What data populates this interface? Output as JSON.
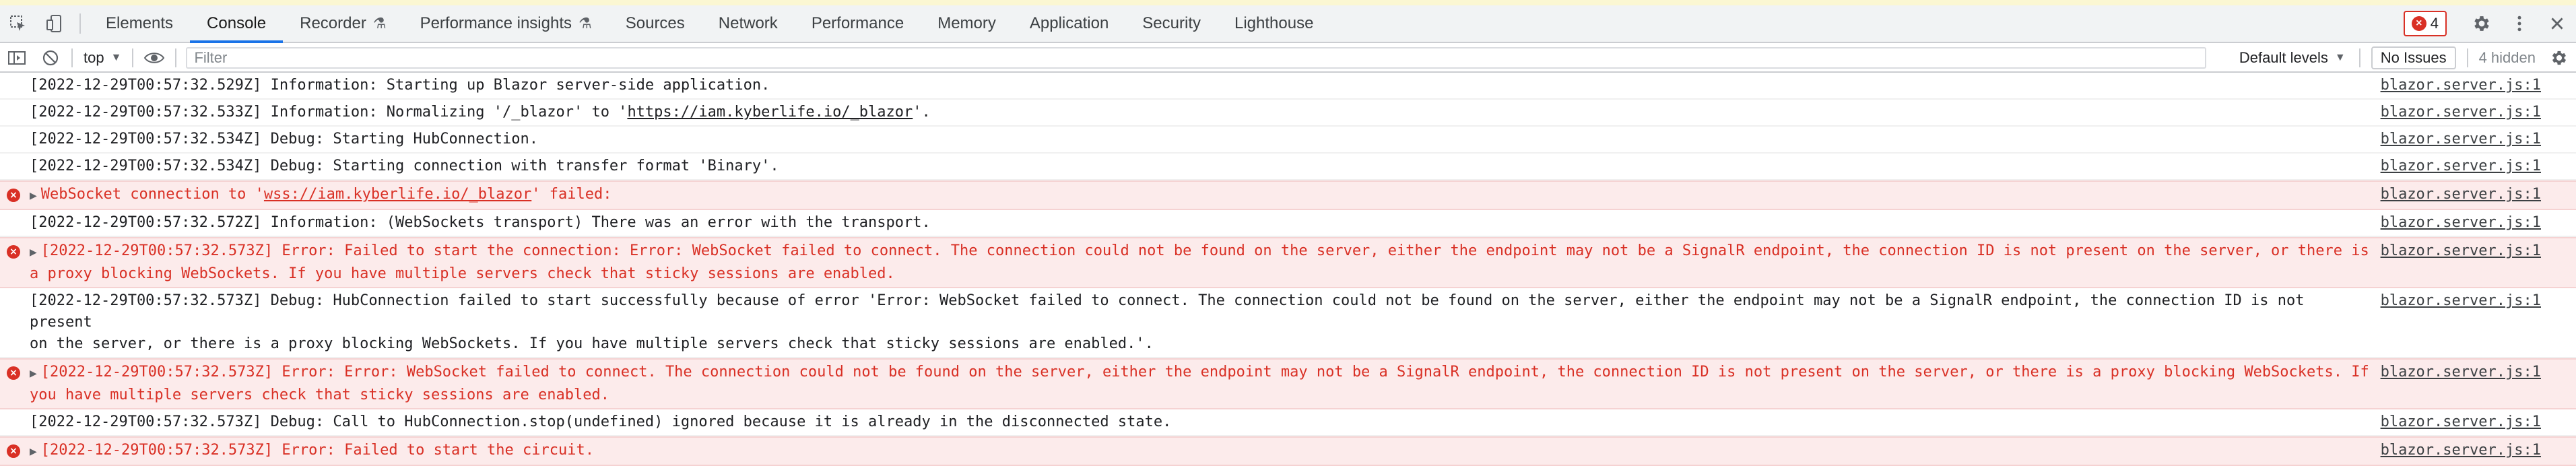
{
  "tabs": [
    {
      "label": "Elements"
    },
    {
      "label": "Console"
    },
    {
      "label": "Recorder"
    },
    {
      "label": "Performance insights"
    },
    {
      "label": "Sources"
    },
    {
      "label": "Network"
    },
    {
      "label": "Performance"
    },
    {
      "label": "Memory"
    },
    {
      "label": "Application"
    },
    {
      "label": "Security"
    },
    {
      "label": "Lighthouse"
    }
  ],
  "error_badge": {
    "count": "4"
  },
  "toolbar": {
    "context": "top",
    "filter_placeholder": "Filter",
    "levels": "Default levels",
    "issues": "No Issues",
    "hidden": "4 hidden"
  },
  "colors": {
    "error": "#d93025",
    "error_bg": "#fcebeb",
    "accent": "#1a73e8"
  },
  "icons": [
    "inspect-icon",
    "device-toggle-icon",
    "flask-icon",
    "settings-gear-icon",
    "more-vert-icon",
    "close-icon",
    "sidebar-toggle-icon",
    "clear-console-icon",
    "eye-icon",
    "console-settings-icon",
    "error-circle-icon",
    "expand-arrow-icon"
  ],
  "logs": [
    {
      "level": "info",
      "text": "[2022-12-29T00:57:32.529Z] Information: Starting up Blazor server-side application.",
      "src": "blazor.server.js:1"
    },
    {
      "level": "info",
      "pre": "[2022-12-29T00:57:32.533Z] Information: Normalizing '/_blazor' to '",
      "link": "https://iam.kyberlife.io/_blazor",
      "post": "'.",
      "src": "blazor.server.js:1"
    },
    {
      "level": "info",
      "text": "[2022-12-29T00:57:32.534Z] Debug: Starting HubConnection.",
      "src": "blazor.server.js:1"
    },
    {
      "level": "info",
      "text": "[2022-12-29T00:57:32.534Z] Debug: Starting connection with transfer format 'Binary'.",
      "src": "blazor.server.js:1"
    },
    {
      "level": "error",
      "pre": "WebSocket connection to '",
      "link": "wss://iam.kyberlife.io/_blazor",
      "post": "' failed:",
      "src": "blazor.server.js:1"
    },
    {
      "level": "info",
      "text": "[2022-12-29T00:57:32.572Z] Information: (WebSockets transport) There was an error with the transport.",
      "src": "blazor.server.js:1"
    },
    {
      "level": "error",
      "text": "[2022-12-29T00:57:32.573Z] Error: Failed to start the connection: Error: WebSocket failed to connect. The connection could not be found on the server, either the endpoint may not be a SignalR endpoint, the connection ID is not present on the server, or there is\na proxy blocking WebSockets. If you have multiple servers check that sticky sessions are enabled.",
      "src": "blazor.server.js:1"
    },
    {
      "level": "info",
      "text": "[2022-12-29T00:57:32.573Z] Debug: HubConnection failed to start successfully because of error 'Error: WebSocket failed to connect. The connection could not be found on the server, either the endpoint may not be a SignalR endpoint, the connection ID is not present\non the server, or there is a proxy blocking WebSockets. If you have multiple servers check that sticky sessions are enabled.'.",
      "src": "blazor.server.js:1"
    },
    {
      "level": "error",
      "text": "[2022-12-29T00:57:32.573Z] Error: Error: WebSocket failed to connect. The connection could not be found on the server, either the endpoint may not be a SignalR endpoint, the connection ID is not present on the server, or there is a proxy blocking WebSockets. If\nyou have multiple servers check that sticky sessions are enabled.",
      "src": "blazor.server.js:1"
    },
    {
      "level": "info",
      "text": "[2022-12-29T00:57:32.573Z] Debug: Call to HubConnection.stop(undefined) ignored because it is already in the disconnected state.",
      "src": "blazor.server.js:1"
    },
    {
      "level": "error",
      "text": "[2022-12-29T00:57:32.573Z] Error: Failed to start the circuit.",
      "src": "blazor.server.js:1"
    }
  ]
}
